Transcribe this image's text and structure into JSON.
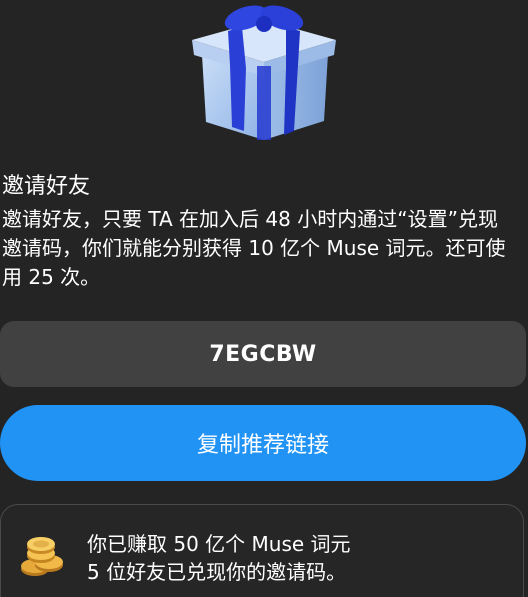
{
  "invite": {
    "title": "邀请好友",
    "description": "邀请好友，只要 TA 在加入后 48 小时内通过“设置”兑现邀请码，你们就能分别获得 10 亿个 Muse 词元。还可使用 25 次。",
    "code": "7EGCBW",
    "copy_button_label": "复制推荐链接"
  },
  "stats": {
    "earned_text": "你已赚取 50 亿个 Muse 词元",
    "redeemed_text": "5 位好友已兑现你的邀请码。"
  },
  "colors": {
    "background": "#242424",
    "code_box": "#414141",
    "accent": "#2093f5"
  },
  "icons": {
    "header": "gift-icon",
    "stats": "coins-icon"
  }
}
